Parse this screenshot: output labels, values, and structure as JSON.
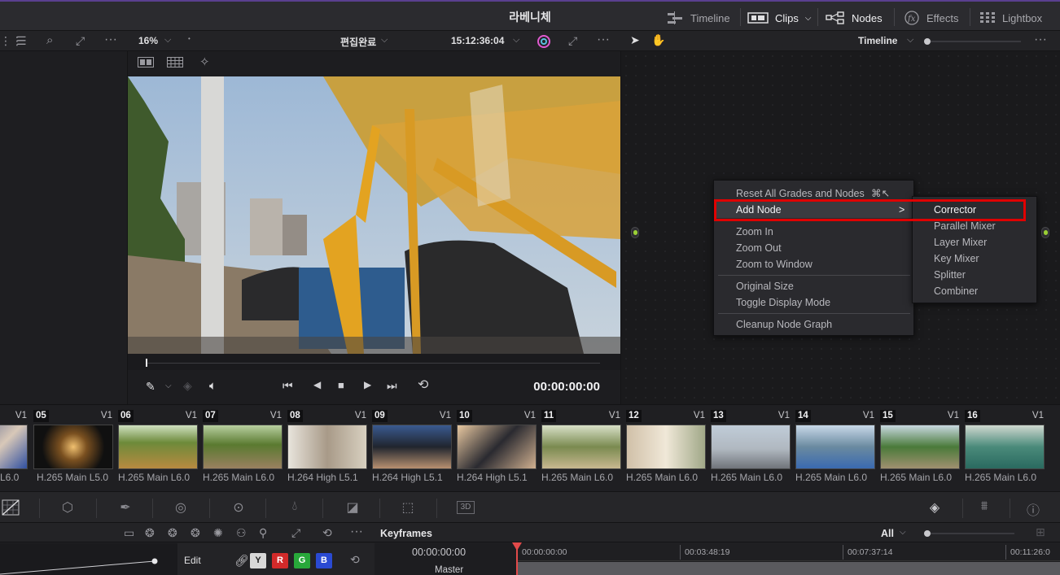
{
  "project_title": "라베니체",
  "top_nav": [
    {
      "label": "Timeline",
      "icon": "timeline-icon",
      "active": false
    },
    {
      "label": "Clips",
      "icon": "clips-icon",
      "active": true
    },
    {
      "label": "Nodes",
      "icon": "nodes-icon",
      "active": true
    },
    {
      "label": "Effects",
      "icon": "fx-icon",
      "active": false
    },
    {
      "label": "Lightbox",
      "icon": "lightbox-icon",
      "active": false
    }
  ],
  "viewer_toolbar": {
    "zoom": "16%",
    "timeline_name": "편집완료",
    "source_timecode": "15:12:36:04"
  },
  "node_toolbar": {
    "mode": "Timeline"
  },
  "viewer": {
    "timecode": "00:00:00:00"
  },
  "context_menu": {
    "items": [
      {
        "label": "Reset All Grades and Nodes",
        "shortcut": "⌘↖"
      },
      {
        "label": "Add Node",
        "arrow": ">",
        "highlighted": true
      },
      {
        "label": "Zoom In"
      },
      {
        "label": "Zoom Out"
      },
      {
        "label": "Zoom to Window"
      },
      {
        "label": "Original Size"
      },
      {
        "label": "Toggle Display Mode"
      },
      {
        "label": "Cleanup Node Graph"
      }
    ],
    "submenu": [
      "Corrector",
      "Parallel Mixer",
      "Layer Mixer",
      "Key Mixer",
      "Splitter",
      "Combiner"
    ]
  },
  "clips": [
    {
      "num": "",
      "track": "V1",
      "codec": "L6.0"
    },
    {
      "num": "05",
      "track": "V1",
      "codec": "H.265 Main L5.0"
    },
    {
      "num": "06",
      "track": "V1",
      "codec": "H.265 Main L6.0"
    },
    {
      "num": "07",
      "track": "V1",
      "codec": "H.265 Main L6.0"
    },
    {
      "num": "08",
      "track": "V1",
      "codec": "H.264 High L5.1"
    },
    {
      "num": "09",
      "track": "V1",
      "codec": "H.264 High L5.1"
    },
    {
      "num": "10",
      "track": "V1",
      "codec": "H.264 High L5.1"
    },
    {
      "num": "11",
      "track": "V1",
      "codec": "H.265 Main L6.0"
    },
    {
      "num": "12",
      "track": "V1",
      "codec": "H.265 Main L6.0"
    },
    {
      "num": "13",
      "track": "V1",
      "codec": "H.265 Main L6.0"
    },
    {
      "num": "14",
      "track": "V1",
      "codec": "H.265 Main L6.0"
    },
    {
      "num": "15",
      "track": "V1",
      "codec": "H.265 Main L6.0"
    },
    {
      "num": "16",
      "track": "V1",
      "codec": "H.265 Main L6.0"
    }
  ],
  "bottom": {
    "keyframes_title": "Keyframes",
    "keyframes_filter": "All",
    "edit_label": "Edit",
    "channels": [
      "Y",
      "R",
      "G",
      "B"
    ],
    "ruler": [
      "00:00:00:00",
      "00:03:48:19",
      "00:07:37:14",
      "00:11:26:0"
    ],
    "timecode": "00:00:00:00",
    "master_label": "Master"
  },
  "colors": {
    "accent_red": "#e00000",
    "node_green": "#9bd035",
    "playhead": "#e24a4a"
  }
}
